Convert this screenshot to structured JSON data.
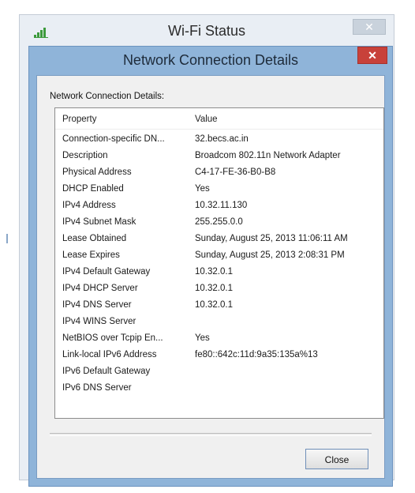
{
  "back_window": {
    "title": "Wi-Fi Status",
    "close_glyph": "✕",
    "icon": "wifi-signal-icon"
  },
  "dialog": {
    "title": "Network Connection Details",
    "close_glyph": "✕",
    "section_label": "Network Connection Details:",
    "columns": {
      "property": "Property",
      "value": "Value"
    },
    "rows": [
      {
        "property": "Connection-specific DN...",
        "value": "32.becs.ac.in"
      },
      {
        "property": "Description",
        "value": "Broadcom 802.11n Network Adapter"
      },
      {
        "property": "Physical Address",
        "value": "C4-17-FE-36-B0-B8"
      },
      {
        "property": "DHCP Enabled",
        "value": "Yes"
      },
      {
        "property": "IPv4 Address",
        "value": "10.32.11.130"
      },
      {
        "property": "IPv4 Subnet Mask",
        "value": "255.255.0.0"
      },
      {
        "property": "Lease Obtained",
        "value": "Sunday, August 25, 2013 11:06:11 AM"
      },
      {
        "property": "Lease Expires",
        "value": "Sunday, August 25, 2013 2:08:31 PM"
      },
      {
        "property": "IPv4 Default Gateway",
        "value": "10.32.0.1"
      },
      {
        "property": "IPv4 DHCP Server",
        "value": "10.32.0.1"
      },
      {
        "property": "IPv4 DNS Server",
        "value": "10.32.0.1"
      },
      {
        "property": "IPv4 WINS Server",
        "value": ""
      },
      {
        "property": "NetBIOS over Tcpip En...",
        "value": "Yes"
      },
      {
        "property": "Link-local IPv6 Address",
        "value": "fe80::642c:11d:9a35:135a%13"
      },
      {
        "property": "IPv6 Default Gateway",
        "value": ""
      },
      {
        "property": "IPv6 DNS Server",
        "value": ""
      }
    ],
    "close_button_label": "Close"
  },
  "colors": {
    "dialog_frame": "#8fb4d9",
    "close_red": "#c8413a",
    "signal_green": "#3c9a3c"
  }
}
